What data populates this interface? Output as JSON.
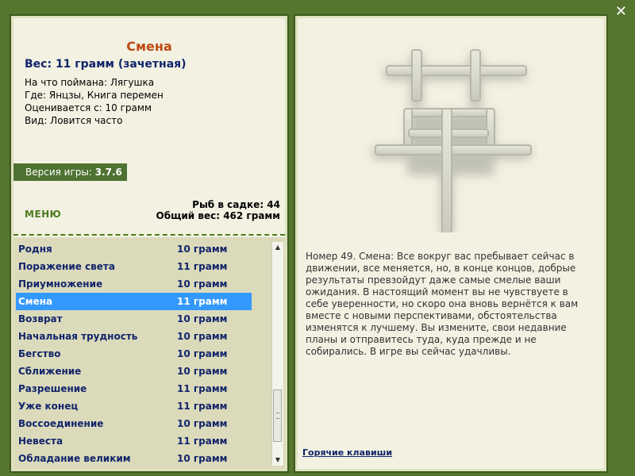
{
  "close_icon": "close-icon",
  "fish": {
    "title": "Смена",
    "weight_line": "Вес: 11 грамм (зачетная)",
    "caught_on": "На что поймана: Лягушка",
    "location": "Где: Янцзы, Книга перемен",
    "rated_from": "Оценивается с: 10 грамм",
    "type": "Вид: Ловится часто"
  },
  "version": {
    "label": "Версия игры:",
    "value": "3.7.6"
  },
  "menu_label": "МЕНЮ",
  "stats": {
    "keepnet": "Рыб в садке: 44",
    "total_weight": "Общий вес: 462 грамм"
  },
  "list": [
    {
      "name": "Родня",
      "weight": "10 грамм"
    },
    {
      "name": "Поражение света",
      "weight": "11 грамм"
    },
    {
      "name": "Приумножение",
      "weight": "10 грамм"
    },
    {
      "name": "Смена",
      "weight": "11 грамм",
      "selected": true
    },
    {
      "name": "Возврат",
      "weight": "10 грамм"
    },
    {
      "name": "Начальная трудность",
      "weight": "10 грамм"
    },
    {
      "name": "Бегство",
      "weight": "10 грамм"
    },
    {
      "name": "Сближение",
      "weight": "10 грамм"
    },
    {
      "name": "Разрешение",
      "weight": "11 грамм"
    },
    {
      "name": "Уже конец",
      "weight": "11 грамм"
    },
    {
      "name": "Воссоединение",
      "weight": "10 грамм"
    },
    {
      "name": "Невеста",
      "weight": "11 грамм"
    },
    {
      "name": "Обладание великим",
      "weight": "10 грамм"
    }
  ],
  "description": "Номер 49. Смена: Все вокруг вас пребывает сейчас в движении, все меняется, но, в конце концов, добрые результаты превзойдут даже самые смелые ваши ожидания. В настоящий момент вы не чувствуете в себе уверенности, но скоро она вновь вернётся к вам вместе с новыми перспективами, обстоятельства изменятся к лучшему. Вы измените, свои недавние планы и отправитесь туда, куда прежде и не собирались. В игре вы сейчас удачливы.",
  "hotkeys_link": "Горячие клавиши"
}
